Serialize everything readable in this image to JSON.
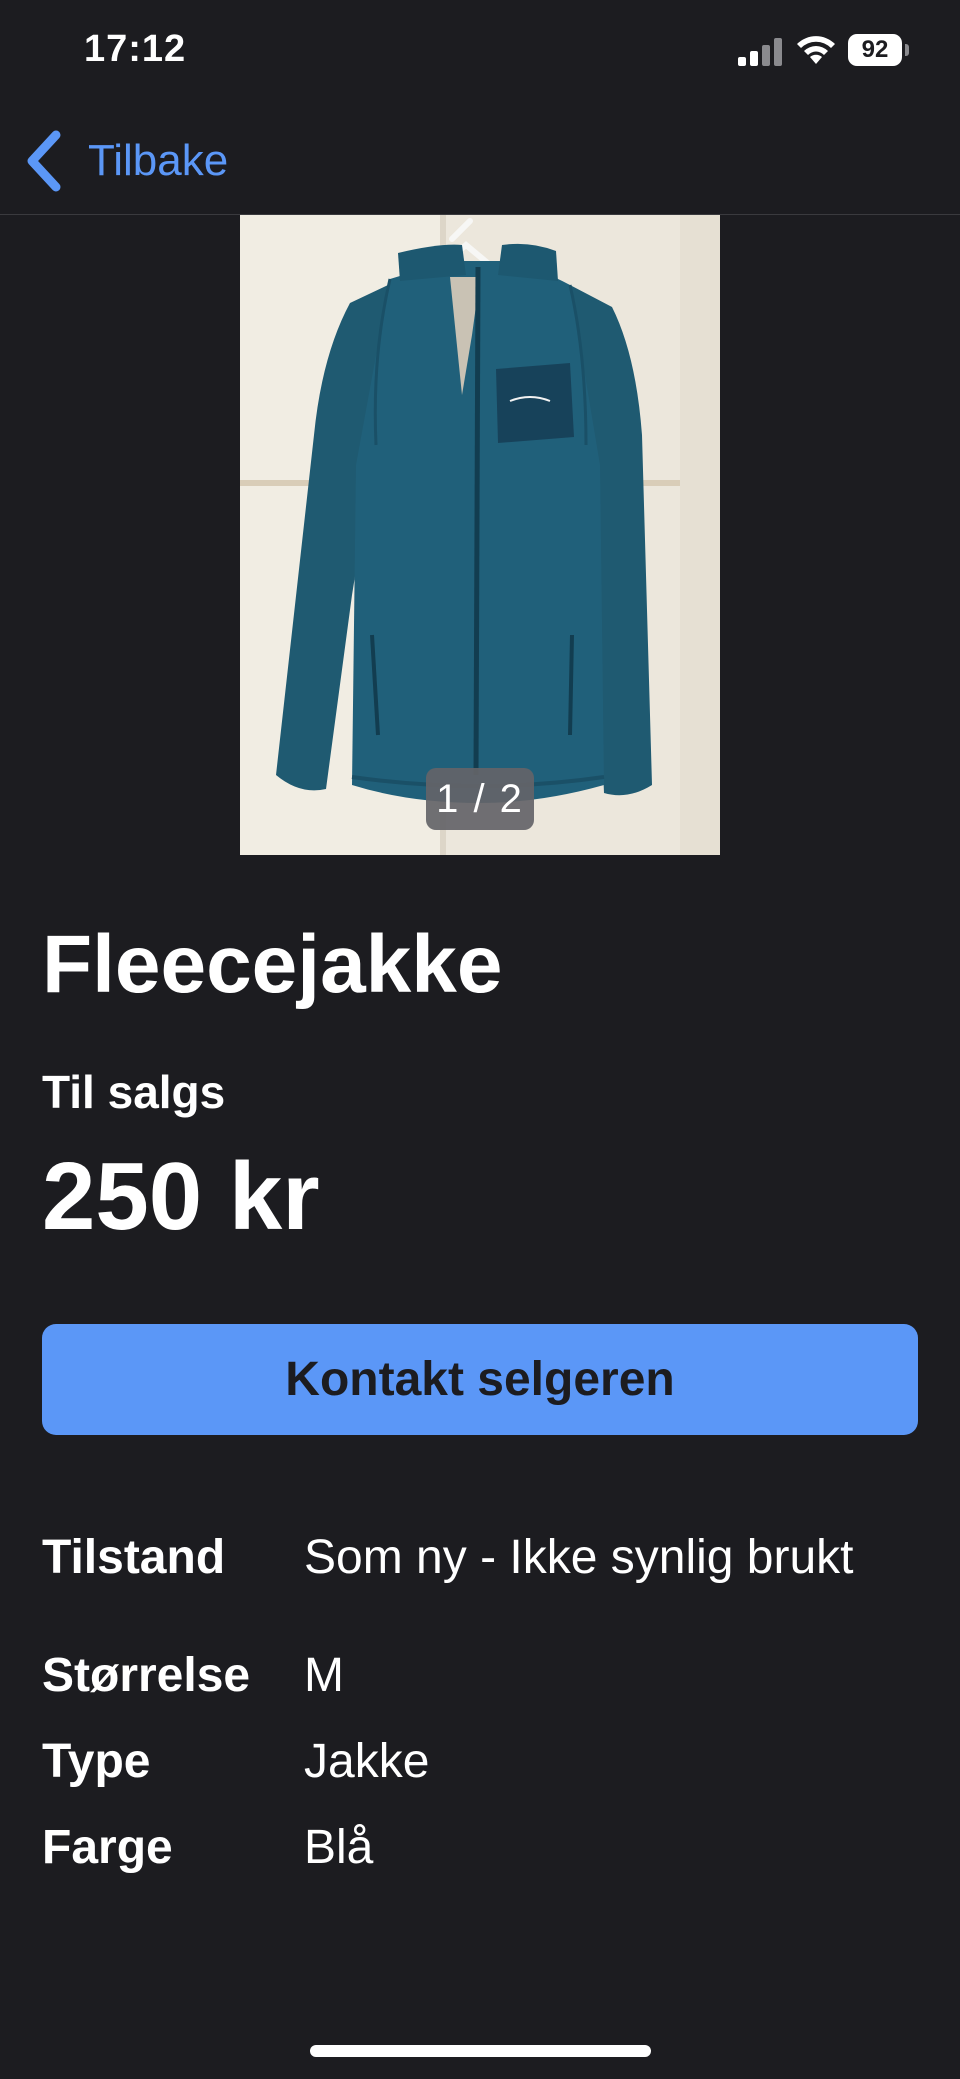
{
  "status_bar": {
    "time": "17:12",
    "battery": "92"
  },
  "nav": {
    "back_label": "Tilbake",
    "back_icon": "chevron-left-icon"
  },
  "carousel": {
    "image": "blue-fleece-jacket-photo",
    "page_indicator": "1 / 2",
    "current": 1,
    "total": 2
  },
  "listing": {
    "title": "Fleecejakke",
    "status": "Til salgs",
    "price": "250 kr",
    "contact_label": "Kontakt selgeren"
  },
  "attributes": [
    {
      "label": "Tilstand",
      "value": "Som ny - Ikke synlig brukt"
    },
    {
      "label": "Størrelse",
      "value": "M"
    },
    {
      "label": "Type",
      "value": "Jakke"
    },
    {
      "label": "Farge",
      "value": "Blå"
    }
  ],
  "colors": {
    "background": "#1c1c20",
    "accent": "#5b97f7",
    "text": "#ffffff"
  }
}
